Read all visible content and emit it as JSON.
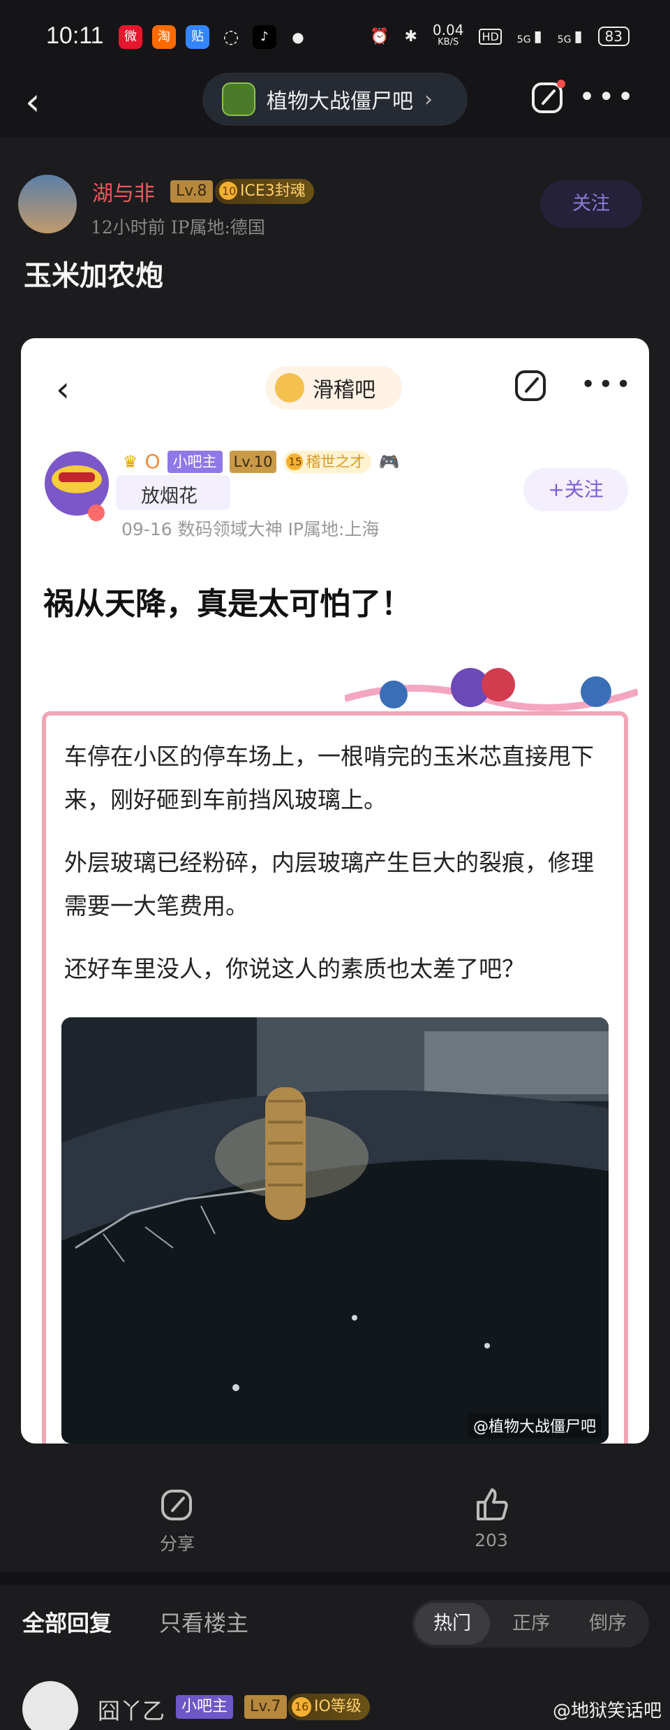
{
  "status_bar": {
    "time": "10:11",
    "app_icons": [
      "weibo-icon",
      "taobao-icon",
      "tieba-icon",
      "messages-icon",
      "tiktok-icon"
    ],
    "net_speed_value": "0.04",
    "net_speed_unit": "KB/S",
    "hd_label": "HD",
    "net1": "5G",
    "net2": "5G",
    "battery": "83"
  },
  "nav": {
    "forum_name": "植物大战僵尸吧"
  },
  "post": {
    "author_name": "湖与非",
    "level": "Lv.8",
    "medal_num": "10",
    "medal_text": "ICE3封魂",
    "meta": "12小时前   IP属地:德国",
    "follow_label": "关注",
    "title": "玉米加农炮"
  },
  "embedded": {
    "forum_name": "滑稽吧",
    "crown_count": "O",
    "role_badge": "小吧主",
    "level": "Lv.10",
    "medal_num": "15",
    "medal_text": "稽世之才",
    "tag": "放烟花",
    "meta": "09-16   数码领域大神   IP属地:上海",
    "follow_label": "+关注",
    "title": "祸从天降，真是太可怕了！",
    "paragraphs": [
      "车停在小区的停车场上，一根啃完的玉米芯直接甩下来，刚好砸到车前挡风玻璃上。",
      "外层玻璃已经粉碎，内层玻璃产生巨大的裂痕，修理需要一大笔费用。",
      "还好车里没人，你说这人的素质也太差了吧？"
    ],
    "photo_watermark": "@植物大战僵尸吧"
  },
  "actions": {
    "share_label": "分享",
    "like_count": "203"
  },
  "reply_tabs": {
    "all": "全部回复",
    "op_only": "只看楼主",
    "sort_hot": "热门",
    "sort_asc": "正序",
    "sort_desc": "倒序"
  },
  "first_reply": {
    "name": "囧丫乙",
    "role_badge": "小吧主",
    "level": "Lv.7",
    "medal_num": "16",
    "medal_text": "IO等级"
  },
  "site_watermark": "@地狱笑话吧",
  "colors": {
    "background": "#1c1c1e",
    "accent": "#8d7bd6",
    "username": "#e85c5c"
  }
}
